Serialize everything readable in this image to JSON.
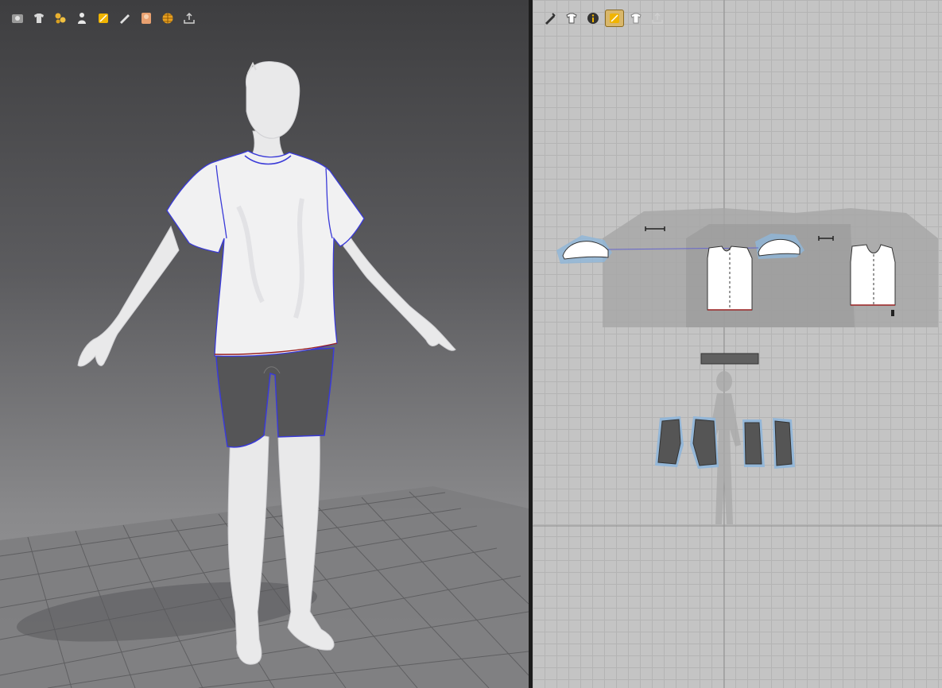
{
  "app": {
    "accent": "#f0b400",
    "seam_color": "#3a3ad8",
    "hem_color": "#9a2222"
  },
  "viewport_3d": {
    "toolbar": [
      {
        "icon": "avatar-display-icon"
      },
      {
        "icon": "garment-display-icon"
      },
      {
        "icon": "fabric-render-icon"
      },
      {
        "icon": "avatar-icon"
      },
      {
        "icon": "texture-icon"
      },
      {
        "icon": "pin-icon"
      },
      {
        "icon": "skin-icon"
      },
      {
        "icon": "mesh-icon"
      },
      {
        "icon": "export-icon"
      }
    ]
  },
  "viewport_2d": {
    "toolbar": [
      {
        "icon": "edit-pattern-icon"
      },
      {
        "icon": "garment-view-icon"
      },
      {
        "icon": "info-icon"
      },
      {
        "icon": "texture-icon",
        "active": true
      },
      {
        "icon": "shirt-icon"
      },
      {
        "icon": "export-icon"
      }
    ]
  }
}
